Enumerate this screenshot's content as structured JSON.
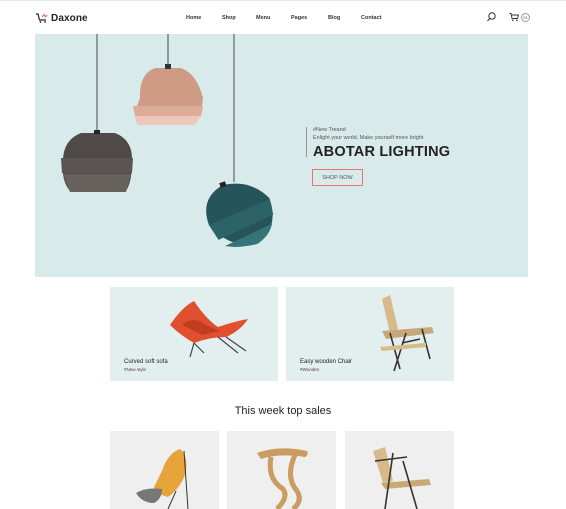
{
  "brand": {
    "name": "Daxone"
  },
  "nav": {
    "items": [
      "Home",
      "Shop",
      "Menu",
      "Pages",
      "Blog",
      "Contact"
    ]
  },
  "header": {
    "cart_count": "01"
  },
  "hero": {
    "tag": "#New Treand",
    "subtitle": "Enlight your world. Make yourself more bright",
    "title": "ABOTAR LIGHTING",
    "cta_label": "SHOP NOW"
  },
  "promos": [
    {
      "title": "Curved soft sofa",
      "subtitle": "#New style"
    },
    {
      "title": "Easy wooden Chair",
      "subtitle": "#Wooden"
    }
  ],
  "top_sales": {
    "title": "This week top sales"
  },
  "colors": {
    "hero_bg": "#d9eaea",
    "accent": "#e7766d",
    "card_bg": "#e3eeee",
    "product_bg": "#efefef"
  },
  "icons": [
    "cart-logo-icon",
    "search-icon",
    "cart-icon"
  ]
}
